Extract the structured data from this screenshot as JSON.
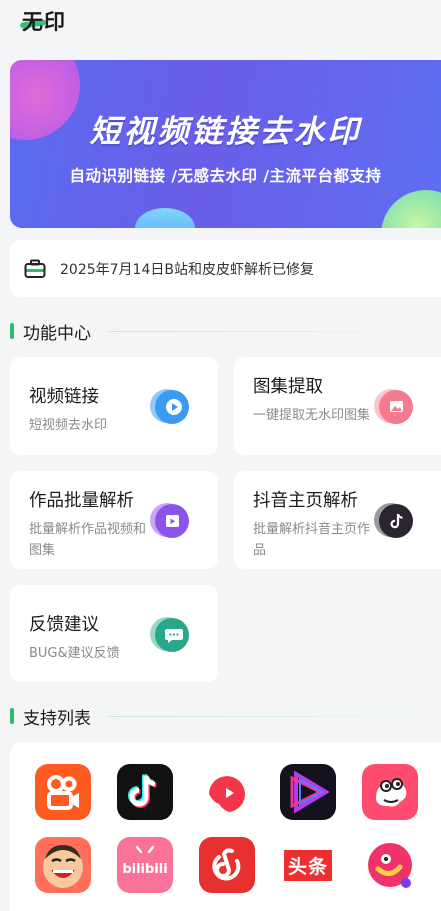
{
  "header": {
    "app_title": "无印"
  },
  "banner": {
    "title": "短视频链接去水印",
    "subtitle": "自动识别链接 /无感去水印 /主流平台都支持"
  },
  "notice": {
    "text": "2025年7月14日B站和皮皮虾解析已修复"
  },
  "sections": {
    "features": "功能中心",
    "support": "支持列表"
  },
  "features": [
    {
      "title": "视频链接",
      "desc": "短视频去水印",
      "icon": "play-icon",
      "color": "#3b9bf0"
    },
    {
      "title": "图集提取",
      "desc": "一键提取无水印图集",
      "icon": "image-icon",
      "color": "#f37b8e"
    },
    {
      "title": "作品批量解析",
      "desc": "批量解析作品视频和图集",
      "icon": "video-folder-icon",
      "color": "#8b55e8"
    },
    {
      "title": "抖音主页解析",
      "desc": "批量解析抖音主页作品",
      "icon": "douyin-icon",
      "color": "#2a2530"
    },
    {
      "title": "反馈建议",
      "desc": "BUG&建议反馈",
      "icon": "chat-icon",
      "color": "#27a88a"
    }
  ],
  "platforms": [
    {
      "name": "kuaishou-icon"
    },
    {
      "name": "douyin-icon"
    },
    {
      "name": "weishi-icon"
    },
    {
      "name": "haokan-icon"
    },
    {
      "name": "pipixia-icon"
    },
    {
      "name": "zuiyou-icon"
    },
    {
      "name": "bilibili-icon",
      "label": "bilibili"
    },
    {
      "name": "netease-music-icon"
    },
    {
      "name": "toutiao-icon",
      "label": "头条"
    },
    {
      "name": "pipigaoxiao-icon"
    }
  ]
}
